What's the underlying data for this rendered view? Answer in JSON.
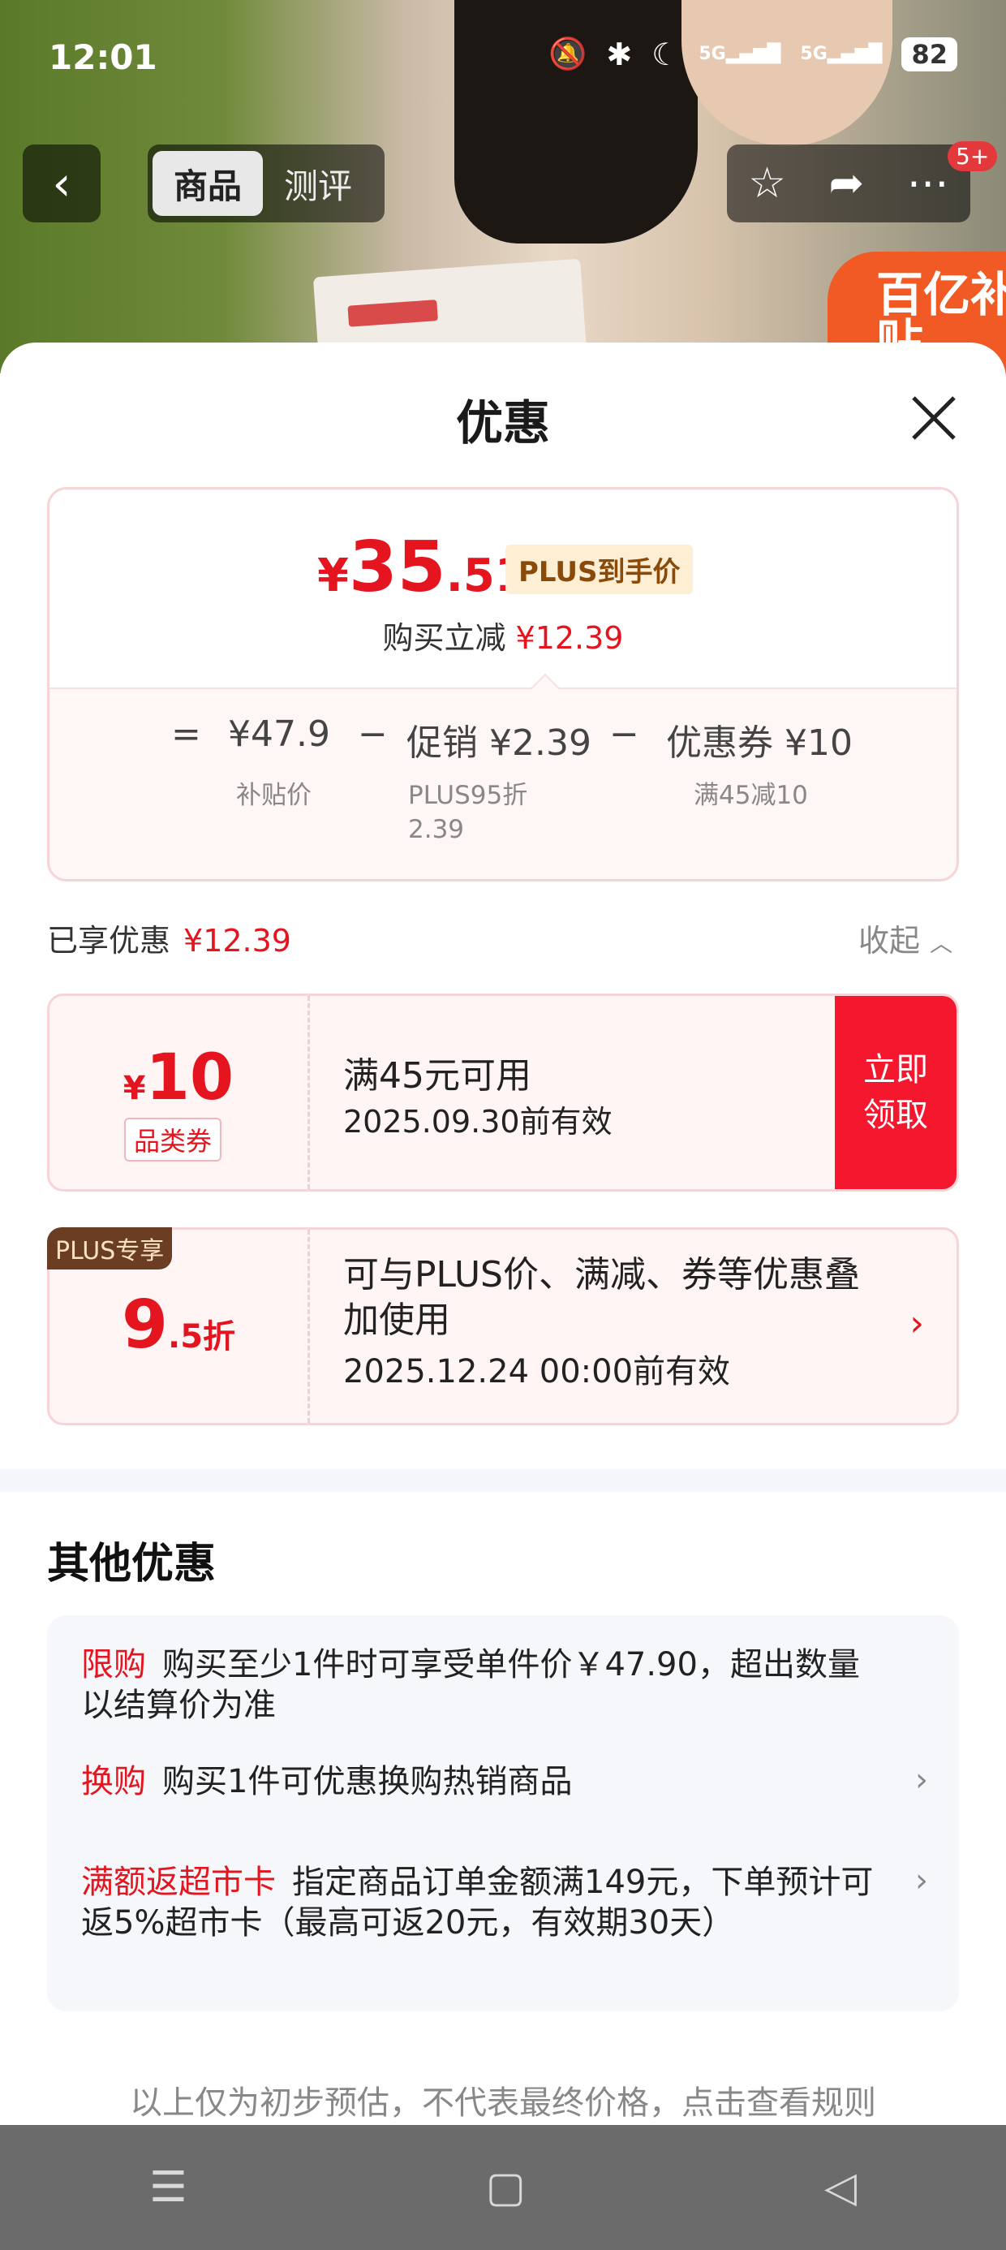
{
  "status_bar": {
    "time": "12:01",
    "network1": "5G",
    "network2": "5G",
    "battery": "82"
  },
  "nav": {
    "tabs": [
      {
        "label": "商品",
        "active": true
      },
      {
        "label": "测评",
        "active": false
      }
    ],
    "badge": "5+",
    "promo_badge": "百亿补贴"
  },
  "sheet": {
    "title": "优惠"
  },
  "price_card": {
    "currency": "¥",
    "price_int": "35",
    "price_dec": ".51",
    "plus_tag": "PLUS到手价",
    "save_label": "购买立减",
    "save_amount": "¥12.39",
    "formula": {
      "eq": "=",
      "base": "¥47.9",
      "minus1": "−",
      "promo": "促销 ¥2.39",
      "minus2": "−",
      "coupon": "优惠券 ¥10",
      "base_sub": "补贴价",
      "promo_sub1": "PLUS95折",
      "promo_sub2": "2.39",
      "coupon_sub": "满45减10"
    }
  },
  "enjoyed": {
    "label": "已享优惠",
    "amount": "¥12.39",
    "collapse": "收起"
  },
  "coupon": {
    "currency": "¥",
    "amount": "10",
    "category": "品类券",
    "condition": "满45元可用",
    "valid": "2025.09.30前有效",
    "button": "立即领取"
  },
  "plus_discount": {
    "badge": "PLUS专享",
    "int": "9",
    "dec": ".5折",
    "desc": "可与PLUS价、满减、券等优惠叠加使用",
    "valid": "2025.12.24 00:00前有效"
  },
  "other": {
    "title": "其他优惠",
    "items": [
      {
        "tag": "限购",
        "text": "购买至少1件时可享受单件价￥47.90，超出数量以结算价为准",
        "arrow": false
      },
      {
        "tag": "换购",
        "text": "购买1件可优惠换购热销商品",
        "arrow": true
      },
      {
        "tag": "满额返超市卡",
        "text": "指定商品订单金额满149元，下单预计可返5%超市卡（最高可返20元，有效期30天）",
        "arrow": true
      }
    ]
  },
  "footnote": "以上仅为初步预估，不代表最终价格，点击查看规则",
  "colors": {
    "accent": "#e4151f",
    "coupon_button": "#f5172d",
    "plus_badge_bg": "#6b3e24"
  }
}
